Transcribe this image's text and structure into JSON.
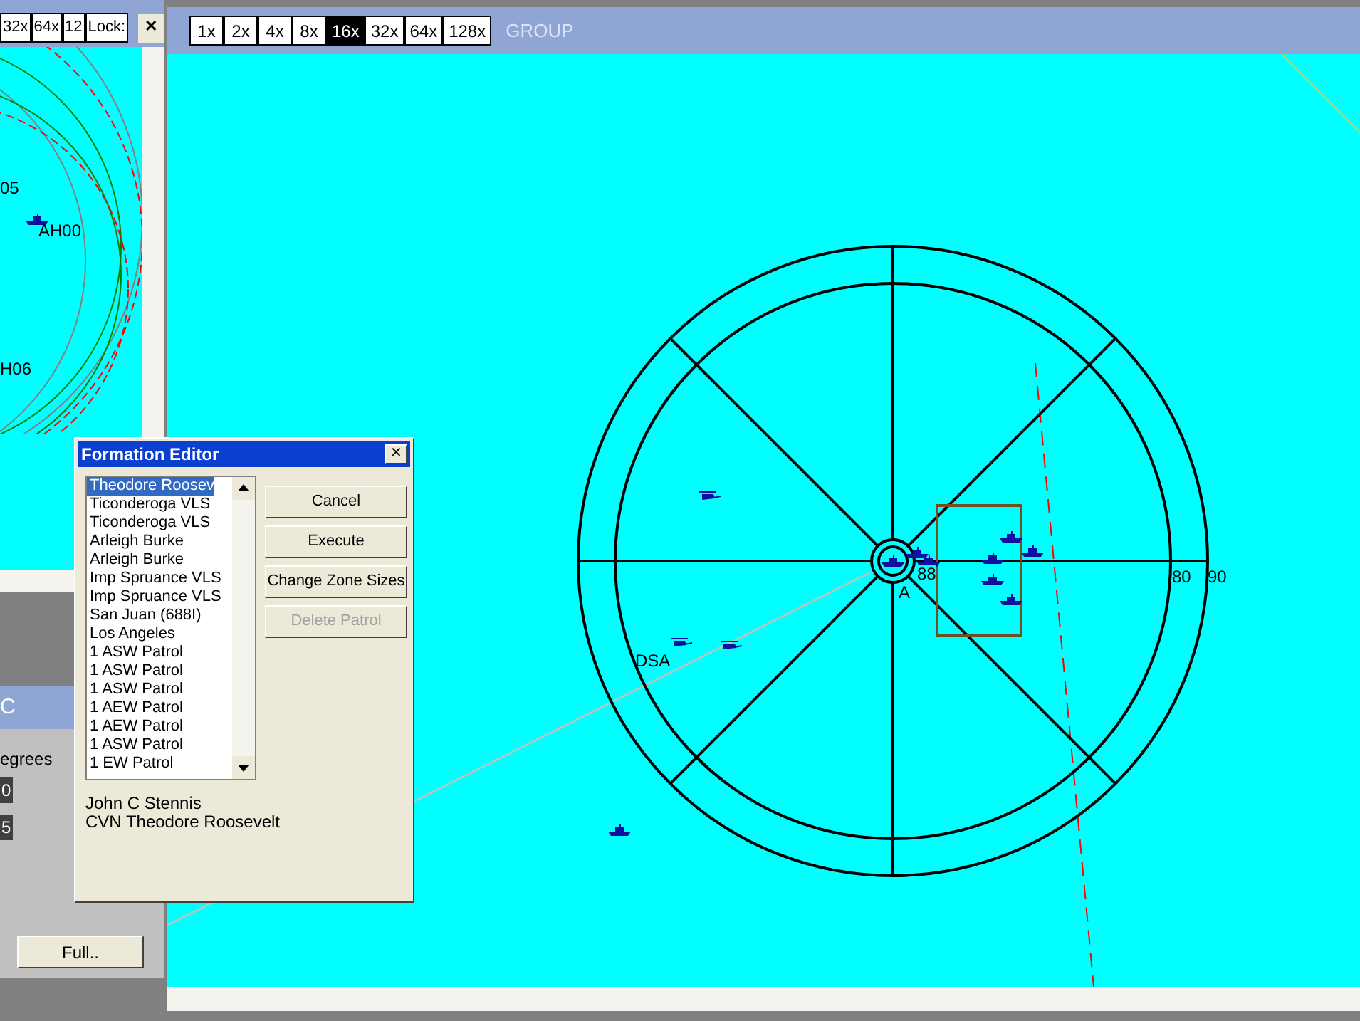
{
  "left_panel": {
    "zoom_buttons": [
      {
        "label": "32x",
        "selected": false
      },
      {
        "label": "64x",
        "selected": false
      },
      {
        "label": "12",
        "selected": false
      },
      {
        "label": "Lock:",
        "selected": false
      }
    ],
    "close": "✕",
    "map_labels": [
      "05",
      "AH00",
      "H06"
    ],
    "sub_title": "C",
    "units_label": "egrees",
    "values": [
      "0",
      "5"
    ],
    "full_button": "Full.."
  },
  "main": {
    "zoom_buttons": [
      {
        "label": "1x",
        "selected": false
      },
      {
        "label": "2x",
        "selected": false
      },
      {
        "label": "4x",
        "selected": false
      },
      {
        "label": "8x",
        "selected": false
      },
      {
        "label": "16x",
        "selected": true
      },
      {
        "label": "32x",
        "selected": false
      },
      {
        "label": "64x",
        "selected": false
      },
      {
        "label": "128x",
        "selected": false
      }
    ],
    "group_label": "GROUP",
    "map_labels": {
      "ring_80": "80",
      "ring_90": "90",
      "contact_a": "A",
      "contact_88": "88",
      "contact_dsa": "DSA"
    }
  },
  "dialog": {
    "title": "Formation Editor",
    "close": "✕",
    "units": [
      {
        "name": "Theodore Roosev",
        "selected": true
      },
      {
        "name": "Ticonderoga VLS",
        "selected": false
      },
      {
        "name": "Ticonderoga VLS",
        "selected": false
      },
      {
        "name": "Arleigh Burke",
        "selected": false
      },
      {
        "name": "Arleigh Burke",
        "selected": false
      },
      {
        "name": "Imp Spruance VLS",
        "selected": false
      },
      {
        "name": "Imp Spruance VLS",
        "selected": false
      },
      {
        "name": "San Juan (688I)",
        "selected": false
      },
      {
        "name": "Los Angeles",
        "selected": false
      },
      {
        "name": "1 ASW Patrol",
        "selected": false
      },
      {
        "name": "1 ASW Patrol",
        "selected": false
      },
      {
        "name": "1 ASW Patrol",
        "selected": false
      },
      {
        "name": "1 AEW Patrol",
        "selected": false
      },
      {
        "name": "1 AEW Patrol",
        "selected": false
      },
      {
        "name": "1 ASW Patrol",
        "selected": false
      },
      {
        "name": "1 EW Patrol",
        "selected": false
      }
    ],
    "buttons": [
      {
        "label": "Cancel",
        "disabled": false
      },
      {
        "label": "Execute",
        "disabled": false
      },
      {
        "label": "Change Zone Sizes",
        "disabled": false
      },
      {
        "label": "Delete Patrol",
        "disabled": true
      }
    ],
    "info": [
      "John C Stennis",
      "CVN Theodore Roosevelt"
    ]
  }
}
